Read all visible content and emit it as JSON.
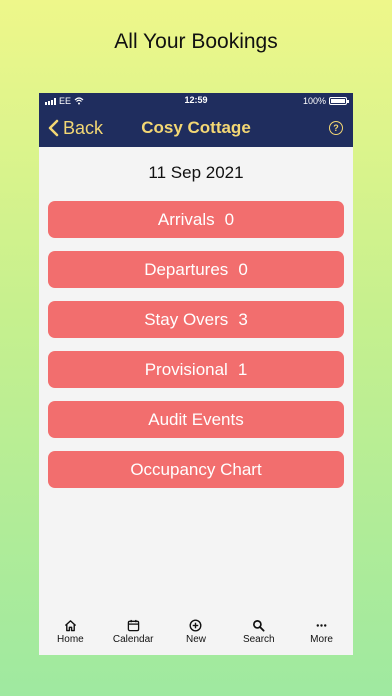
{
  "headline": "All Your Bookings",
  "status": {
    "carrier": "EE",
    "time": "12:59",
    "battery": "100%"
  },
  "nav": {
    "back_label": "Back",
    "title": "Cosy Cottage"
  },
  "date": "11 Sep 2021",
  "buttons": [
    {
      "label": "Arrivals",
      "count": "0"
    },
    {
      "label": "Departures",
      "count": "0"
    },
    {
      "label": "Stay Overs",
      "count": "3"
    },
    {
      "label": "Provisional",
      "count": "1"
    },
    {
      "label": "Audit Events",
      "count": ""
    },
    {
      "label": "Occupancy Chart",
      "count": ""
    }
  ],
  "tabs": [
    {
      "label": "Home",
      "icon": "home-icon"
    },
    {
      "label": "Calendar",
      "icon": "calendar-icon"
    },
    {
      "label": "New",
      "icon": "plus-circle-icon"
    },
    {
      "label": "Search",
      "icon": "search-icon"
    },
    {
      "label": "More",
      "icon": "more-icon"
    }
  ],
  "colors": {
    "navbar": "#1f2d5e",
    "accent": "#f3d774",
    "button": "#f26e6e"
  }
}
